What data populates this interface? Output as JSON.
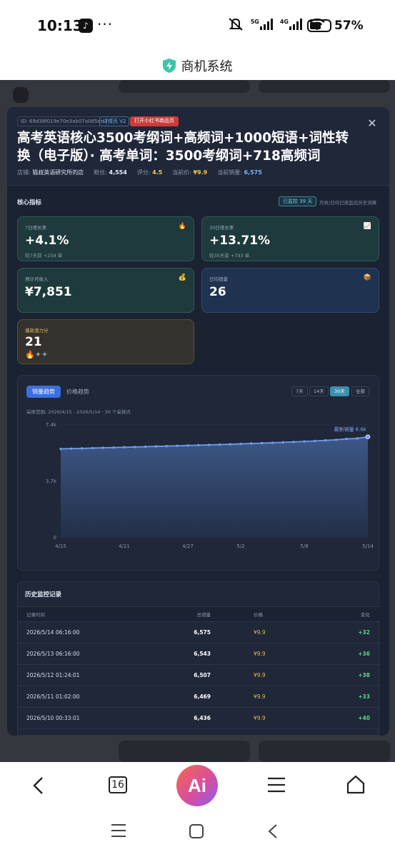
{
  "status_bar": {
    "time": "10:13",
    "app_icon": "tiktok-icon",
    "more": "···",
    "network_1": "5G",
    "network_2": "4G",
    "battery_percent_label": "57%",
    "battery_level": 0.57
  },
  "title_bar": {
    "icon": "shield-bolt-icon",
    "title": "商机系统"
  },
  "modal": {
    "id_tag": "ID: 69d38f019e70e3ab07a085eb",
    "detail_tag": "详情页 V2",
    "open_button": "打开小红书商品页",
    "product_title": "高考英语核心3500考纲词+高频词+1000短语+词性转换（电子版）· 高考单词：3500考纲词+718高频词",
    "meta": {
      "shop_label": "店铺:",
      "shop_name": "猫叔英语研究所的店",
      "fans_label": "粉丝:",
      "fans_value": "4,554",
      "rating_label": "评分:",
      "rating_value": "4.5",
      "price_label": "当前价:",
      "price_value": "¥9.9",
      "sales_label": "当前销量:",
      "sales_value": "6,575"
    },
    "core": {
      "title": "核心指标",
      "monitor_badge": "已监控 39 天",
      "monitor_note": "月收/日均已按监控历史测算"
    },
    "cards": [
      {
        "label": "7日增长率",
        "value": "+4.1%",
        "sub": "较7天前 +259 单",
        "icon": "fire-icon",
        "glyph": "🔥"
      },
      {
        "label": "30日增长率",
        "value": "+13.71%",
        "sub": "较30天前 +793 单",
        "icon": "trend-chart-icon",
        "glyph": "📈"
      },
      {
        "label": "预计月收入",
        "value": "¥7,851",
        "sub": "",
        "icon": "money-bag-icon",
        "glyph": "💰"
      },
      {
        "label": "日均销量",
        "value": "26",
        "sub": "",
        "icon": "box-icon",
        "glyph": "📦"
      },
      {
        "label": "爆款潜力分",
        "value": "21",
        "stars": "🔥✦✦",
        "stars_filled": 1,
        "stars_total": 3
      }
    ],
    "chart_tabs": {
      "sales": "销量趋势",
      "price": "价格趋势"
    },
    "ranges": [
      "7天",
      "14天",
      "30天",
      "全部"
    ],
    "active_range": "30天",
    "range_note": "采样范围: 2026/4/15 - 2026/5/14 · 30 个采样点",
    "latest_label": "最新销量 6.6k",
    "history": {
      "title": "历史监控记录",
      "headers": {
        "time": "记录时间",
        "sales": "总销量",
        "price": "价格",
        "change": "变化"
      },
      "rows": [
        {
          "time": "2026/5/14 06:16:00",
          "sales": "6,575",
          "price": "¥9.9",
          "change": "+32"
        },
        {
          "time": "2026/5/13 06:16:00",
          "sales": "6,543",
          "price": "¥9.9",
          "change": "+36"
        },
        {
          "time": "2026/5/12 01:24:01",
          "sales": "6,507",
          "price": "¥9.9",
          "change": "+38"
        },
        {
          "time": "2026/5/11 01:02:00",
          "sales": "6,469",
          "price": "¥9.9",
          "change": "+33"
        },
        {
          "time": "2026/5/10 00:33:01",
          "sales": "6,436",
          "price": "¥9.9",
          "change": "+40"
        }
      ]
    }
  },
  "chart_data": {
    "type": "area",
    "title": "",
    "x_ticks": [
      "4/15",
      "4/21",
      "4/27",
      "5/2",
      "5/8",
      "5/14"
    ],
    "y_ticks": [
      "0",
      "3.7k",
      "7.4k"
    ],
    "ylim": [
      0,
      7400
    ],
    "series": [
      {
        "values": [
          5782,
          5800,
          5815,
          5835,
          5855,
          5870,
          5890,
          5905,
          5925,
          5945,
          5965,
          5985,
          6005,
          6025,
          6045,
          6065,
          6085,
          6110,
          6135,
          6160,
          6185,
          6210,
          6240,
          6270,
          6300,
          6340,
          6380,
          6436,
          6469,
          6575
        ]
      }
    ],
    "grid": true,
    "color": "#6f9cf0"
  },
  "bottom_nav": {
    "back": "back-icon",
    "tabs_count": "16",
    "ai_label": "Ai",
    "menu": "menu-icon",
    "home": "home-icon"
  }
}
